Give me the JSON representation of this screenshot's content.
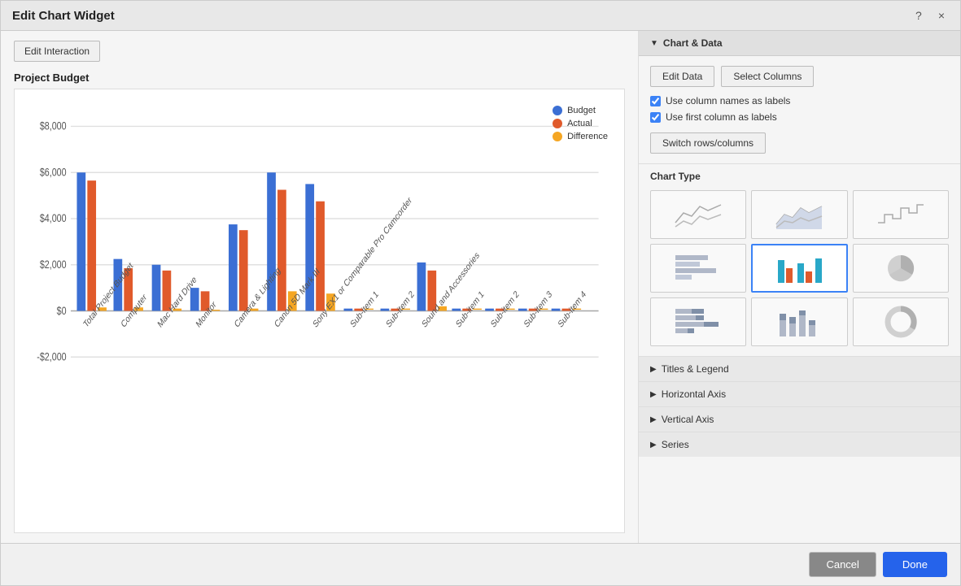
{
  "dialog": {
    "title": "Edit Chart Widget",
    "help_btn": "?",
    "close_btn": "×"
  },
  "left": {
    "edit_interaction_label": "Edit Interaction",
    "chart_title": "Project Budget"
  },
  "right": {
    "chart_data_section": "Chart & Data",
    "edit_data_label": "Edit Data",
    "select_columns_label": "Select Columns",
    "use_column_names_label": "Use column names as labels",
    "use_first_column_label": "Use first column as labels",
    "switch_rows_label": "Switch rows/columns",
    "chart_type_label": "Chart Type",
    "collapsible": [
      {
        "label": "Titles & Legend"
      },
      {
        "label": "Horizontal Axis"
      },
      {
        "label": "Vertical Axis"
      },
      {
        "label": "Series"
      }
    ]
  },
  "footer": {
    "cancel_label": "Cancel",
    "done_label": "Done"
  },
  "legend": {
    "items": [
      {
        "label": "Budget",
        "color": "#3b6fd4"
      },
      {
        "label": "Actual",
        "color": "#e05a2b"
      },
      {
        "label": "Difference",
        "color": "#f5a623"
      }
    ]
  },
  "chart": {
    "categories": [
      "Total Project Budget",
      "Computer",
      "Mac Hard Drive",
      "Monitor",
      "Camera & Lighting",
      "Canon 5D Mark III",
      "Sony EX1 or Comparable Pro Camcorder",
      "Sub-item 1",
      "Sub-item 2",
      "Sound and Accessories",
      "Sub-item 1",
      "Sub-item 2",
      "Sub-item 3",
      "Sub-item 4"
    ],
    "series": {
      "budget": [
        6200,
        1800,
        1600,
        700,
        3000,
        5000,
        4500,
        0,
        0,
        2500,
        0,
        0,
        0,
        0
      ],
      "actual": [
        6000,
        1600,
        1400,
        600,
        2800,
        4200,
        3800,
        0,
        0,
        2200,
        0,
        0,
        0,
        0
      ],
      "difference": [
        200,
        200,
        200,
        100,
        200,
        800,
        700,
        0,
        0,
        300,
        0,
        0,
        0,
        0
      ]
    },
    "y_labels": [
      "$8,000",
      "$6,000",
      "$4,000",
      "$2,000",
      "$0",
      "-$2,000"
    ],
    "y_values": [
      8000,
      6000,
      4000,
      2000,
      0,
      -2000
    ]
  }
}
